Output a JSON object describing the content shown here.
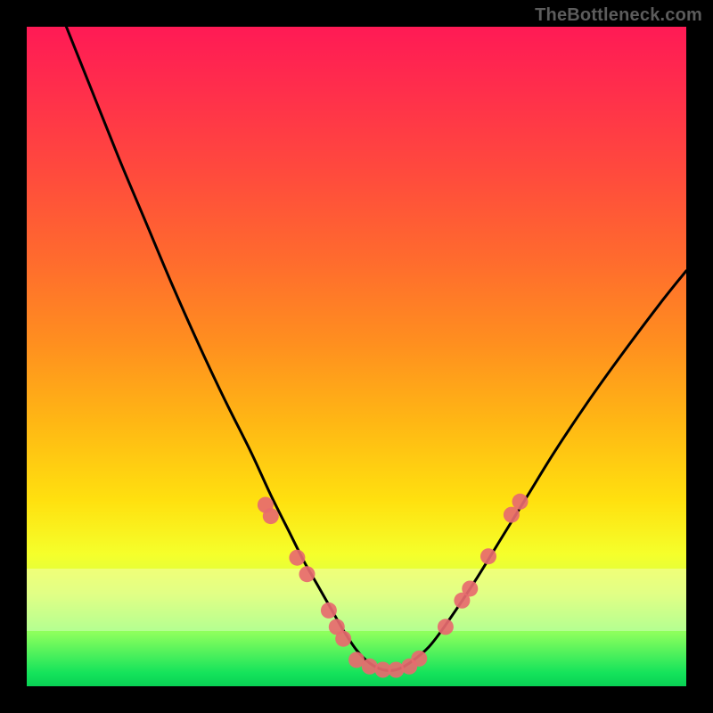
{
  "watermark": "TheBottleneck.com",
  "chart_data": {
    "type": "line",
    "title": "",
    "xlabel": "",
    "ylabel": "",
    "xlim": [
      0,
      100
    ],
    "ylim": [
      0,
      100
    ],
    "grid": false,
    "series": [
      {
        "name": "bottleneck-curve",
        "x": [
          6,
          10,
          14,
          18,
          22,
          26,
          30,
          34,
          37,
          40,
          42,
          44,
          46,
          48,
          50,
          52,
          54,
          56,
          58,
          61,
          64,
          68,
          72,
          76,
          80,
          85,
          90,
          96,
          100
        ],
        "y": [
          100,
          90,
          80,
          70.5,
          61,
          52,
          43.5,
          35.5,
          29,
          23,
          19,
          15.5,
          12,
          8.5,
          5.5,
          3.5,
          2.5,
          2.5,
          3.5,
          6,
          10,
          16,
          22.5,
          29,
          35.5,
          43,
          50,
          58,
          63
        ],
        "color": "#000000"
      }
    ],
    "markers": [
      {
        "x": 36.2,
        "y": 27.5
      },
      {
        "x": 37.0,
        "y": 25.8
      },
      {
        "x": 41.0,
        "y": 19.5
      },
      {
        "x": 42.5,
        "y": 17.0
      },
      {
        "x": 45.8,
        "y": 11.5
      },
      {
        "x": 47.0,
        "y": 9.0
      },
      {
        "x": 48.0,
        "y": 7.2
      },
      {
        "x": 50.0,
        "y": 4.0
      },
      {
        "x": 52.0,
        "y": 3.0
      },
      {
        "x": 54.0,
        "y": 2.5
      },
      {
        "x": 56.0,
        "y": 2.5
      },
      {
        "x": 58.0,
        "y": 3.0
      },
      {
        "x": 59.5,
        "y": 4.2
      },
      {
        "x": 63.5,
        "y": 9.0
      },
      {
        "x": 66.0,
        "y": 13.0
      },
      {
        "x": 67.2,
        "y": 14.8
      },
      {
        "x": 70.0,
        "y": 19.7
      },
      {
        "x": 73.5,
        "y": 26.0
      },
      {
        "x": 74.8,
        "y": 28.0
      }
    ],
    "marker_color": "#e76a6f",
    "bands": [
      {
        "name": "pale-highlight",
        "y_from": 8,
        "y_to": 18,
        "color": "rgba(255,255,255,0.33)"
      }
    ],
    "annotations": []
  }
}
